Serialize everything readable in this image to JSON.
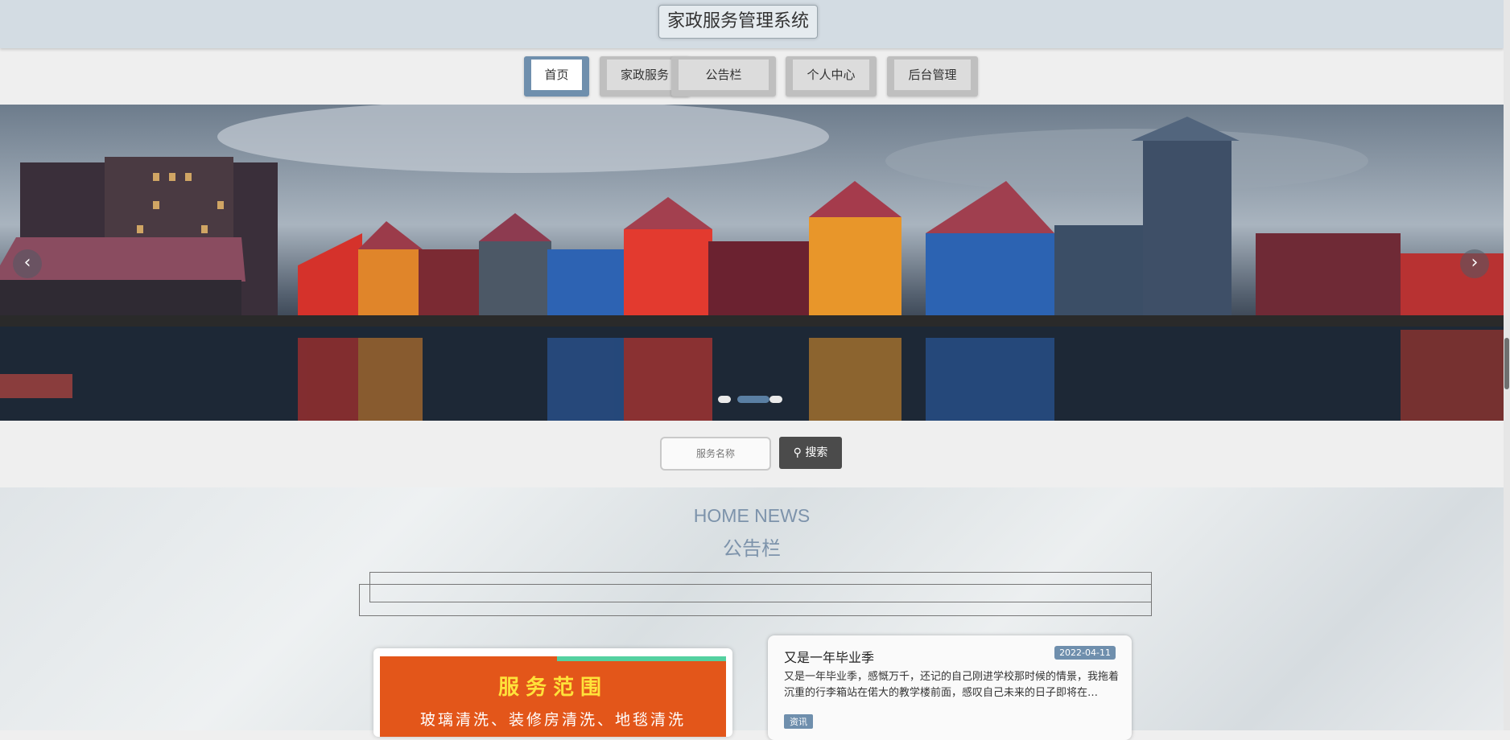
{
  "site": {
    "title": "家政服务管理系统"
  },
  "nav": {
    "items": [
      {
        "label": "首页",
        "active": true
      },
      {
        "label": "家政服务",
        "active": false
      },
      {
        "label": "公告栏",
        "active": false
      },
      {
        "label": "个人中心",
        "active": false
      },
      {
        "label": "后台管理",
        "active": false
      }
    ]
  },
  "carousel": {
    "prev_icon": "chevron-left-icon",
    "next_icon": "chevron-right-icon",
    "slide_count": 3,
    "active_index": 1
  },
  "search": {
    "placeholder": "服务名称",
    "button_label": "搜索",
    "button_icon": "search-icon"
  },
  "news": {
    "heading_en": "HOME NEWS",
    "heading_cn": "公告栏",
    "promo": {
      "title": "服务范围",
      "line": "玻璃清洗、装修房清洗、地毯清洗"
    },
    "items": [
      {
        "title": "又是一年毕业季",
        "date": "2022-04-11",
        "description": "又是一年毕业季，感慨万千，还记的自己刚进学校那时候的情景，我拖着沉重的行李箱站在偌大的教学楼前面，感叹自己未来的日子即将在…",
        "tag": "资讯"
      }
    ]
  },
  "colors": {
    "accent": "#6f8fad",
    "topbar": "#d3dce3",
    "search_button": "#4b4b4b",
    "promo_bg": "#e3561a",
    "promo_title": "#ffe23a"
  }
}
